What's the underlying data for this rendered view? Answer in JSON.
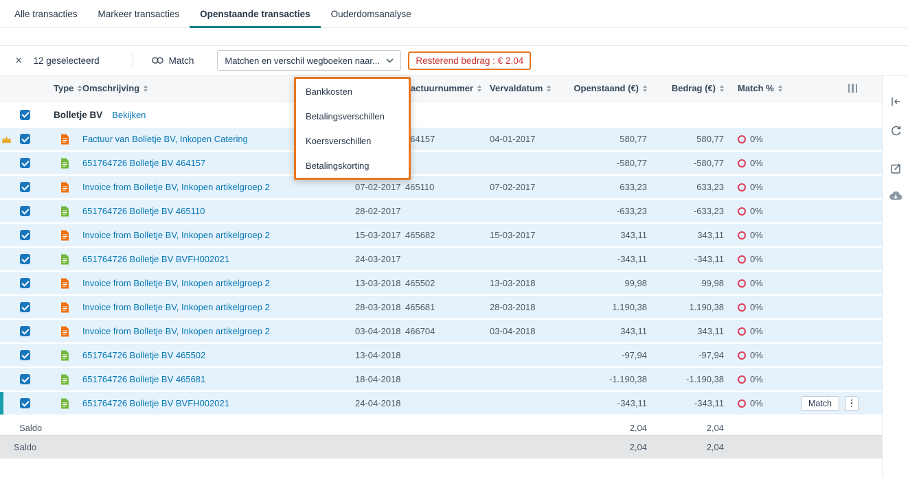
{
  "tabs": [
    {
      "label": "Alle transacties",
      "active": false
    },
    {
      "label": "Markeer transacties",
      "active": false
    },
    {
      "label": "Openstaande transacties",
      "active": true
    },
    {
      "label": "Ouderdomsanalyse",
      "active": false
    }
  ],
  "toolbar": {
    "selected_count": "12 geselecteerd",
    "match_label": "Match",
    "match_dropdown_value": "Matchen en verschil wegboeken naar...",
    "remaining_badge": "Resterend bedrag : € 2,04"
  },
  "dropdown_menu": {
    "items": [
      "Bankkosten",
      "Betalingsverschillen",
      "Koersverschillen",
      "Betalingskorting"
    ]
  },
  "table": {
    "headers": {
      "type": "Type",
      "omschrijving": "Omschrijving",
      "factuurnummer": "Factuurnummer",
      "vervaldatum": "Vervaldatum",
      "openstaand": "Openstaand (€)",
      "bedrag": "Bedrag (€)",
      "match": "Match %"
    },
    "group": {
      "name": "Bolletje BV",
      "action_label": "Bekijken"
    },
    "rows": [
      {
        "type": "purchase",
        "star": true,
        "omschrijving": "Factuur van Bolletje BV, Inkopen Catering",
        "datum": "",
        "factuurnummer": "464157",
        "vervaldatum": "04-01-2017",
        "openstaand": "580,77",
        "bedrag": "580,77",
        "match": "0%"
      },
      {
        "type": "payment",
        "star": false,
        "omschrijving": "651764726 Bolletje BV 464157",
        "datum": "",
        "factuurnummer": "",
        "vervaldatum": "",
        "openstaand": "-580,77",
        "bedrag": "-580,77",
        "match": "0%"
      },
      {
        "type": "purchase",
        "star": false,
        "omschrijving": "Invoice from Bolletje BV, Inkopen artikelgroep 2",
        "datum": "07-02-2017",
        "factuurnummer": "465110",
        "vervaldatum": "07-02-2017",
        "openstaand": "633,23",
        "bedrag": "633,23",
        "match": "0%"
      },
      {
        "type": "payment",
        "star": false,
        "omschrijving": "651764726 Bolletje BV 465110",
        "datum": "28-02-2017",
        "factuurnummer": "",
        "vervaldatum": "",
        "openstaand": "-633,23",
        "bedrag": "-633,23",
        "match": "0%"
      },
      {
        "type": "purchase",
        "star": false,
        "omschrijving": "Invoice from Bolletje BV, Inkopen artikelgroep 2",
        "datum": "15-03-2017",
        "factuurnummer": "465682",
        "vervaldatum": "15-03-2017",
        "openstaand": "343,11",
        "bedrag": "343,11",
        "match": "0%"
      },
      {
        "type": "payment",
        "star": false,
        "omschrijving": "651764726 Bolletje BV BVFH002021",
        "datum": "24-03-2017",
        "factuurnummer": "",
        "vervaldatum": "",
        "openstaand": "-343,11",
        "bedrag": "-343,11",
        "match": "0%"
      },
      {
        "type": "purchase",
        "star": false,
        "omschrijving": "Invoice from Bolletje BV, Inkopen artikelgroep 2",
        "datum": "13-03-2018",
        "factuurnummer": "465502",
        "vervaldatum": "13-03-2018",
        "openstaand": "99,98",
        "bedrag": "99,98",
        "match": "0%"
      },
      {
        "type": "purchase",
        "star": false,
        "omschrijving": "Invoice from Bolletje BV, Inkopen artikelgroep 2",
        "datum": "28-03-2018",
        "factuurnummer": "465681",
        "vervaldatum": "28-03-2018",
        "openstaand": "1.190,38",
        "bedrag": "1.190,38",
        "match": "0%"
      },
      {
        "type": "purchase",
        "star": false,
        "omschrijving": "Invoice from Bolletje BV, Inkopen artikelgroep 2",
        "datum": "03-04-2018",
        "factuurnummer": "466704",
        "vervaldatum": "03-04-2018",
        "openstaand": "343,11",
        "bedrag": "343,11",
        "match": "0%"
      },
      {
        "type": "payment",
        "star": false,
        "omschrijving": "651764726 Bolletje BV 465502",
        "datum": "13-04-2018",
        "factuurnummer": "",
        "vervaldatum": "",
        "openstaand": "-97,94",
        "bedrag": "-97,94",
        "match": "0%"
      },
      {
        "type": "payment",
        "star": false,
        "omschrijving": "651764726 Bolletje BV 465681",
        "datum": "18-04-2018",
        "factuurnummer": "",
        "vervaldatum": "",
        "openstaand": "-1.190,38",
        "bedrag": "-1.190,38",
        "match": "0%"
      },
      {
        "type": "payment",
        "star": false,
        "omschrijving": "651764726 Bolletje BV BVFH002021",
        "datum": "24-04-2018",
        "factuurnummer": "",
        "vervaldatum": "",
        "openstaand": "-343,11",
        "bedrag": "-343,11",
        "match": "0%",
        "highlight": true,
        "actions": true
      }
    ],
    "saldo": {
      "label": "Saldo",
      "openstaand": "2,04",
      "bedrag": "2,04"
    }
  },
  "row_actions": {
    "match_button": "Match"
  },
  "icons": {
    "clear_selection": "close-icon",
    "match": "link-icon",
    "dropdown": "chevron-down-icon",
    "primary_row": "crown-icon",
    "row_type_purchase": "purchase-invoice-icon",
    "row_type_payment": "payment-icon",
    "match_progress": "progress-ring",
    "column_chooser": "column-chooser-icon",
    "row_menu": "kebab-menu-icon",
    "rail": [
      "collapse-panel-icon",
      "redo-icon",
      "edit-icon",
      "cloud-download-icon"
    ]
  },
  "colors": {
    "accent_teal": "#12808d",
    "selected_row": "#e6f2fb",
    "annotation_orange": "#e8761d",
    "link_blue": "#0077b6",
    "checkbox_blue": "#1b77bd",
    "remaining_red": "#c9302c",
    "ring_red": "#dd3c55",
    "invoice_orange": "#ee7010",
    "payment_green": "#74b83f"
  }
}
